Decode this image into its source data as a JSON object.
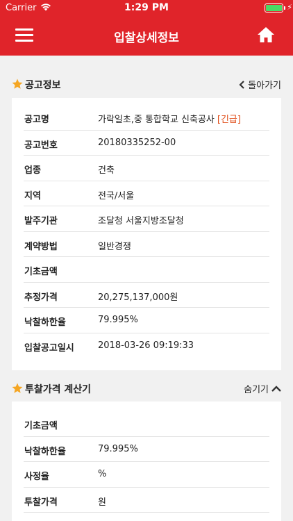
{
  "status_bar": {
    "carrier": "Carrier",
    "time": "1:29 PM"
  },
  "navbar": {
    "title": "입찰상세정보",
    "menu_icon": "hamburger-menu-icon",
    "home_icon": "home-icon"
  },
  "colors": {
    "primary": "#e0242a",
    "star": "#f5a623",
    "tag": "#e04e1a",
    "battery": "#4cd964"
  },
  "notice_section": {
    "title": "공고정보",
    "back_label": "돌아가기",
    "rows": [
      {
        "label": "공고명",
        "value": "가락일초,중 통합학교 신축공사",
        "tag": "[긴급]"
      },
      {
        "label": "공고번호",
        "value": "20180335252-00"
      },
      {
        "label": "업종",
        "value": "건축"
      },
      {
        "label": "지역",
        "value": "전국/서울"
      },
      {
        "label": "발주기관",
        "value": "조달청 서울지방조달청"
      },
      {
        "label": "계약방법",
        "value": "일반경쟁"
      },
      {
        "label": "기초금액",
        "value": ""
      },
      {
        "label": "추정가격",
        "value": "20,275,137,000원"
      },
      {
        "label": "낙찰하한율",
        "value": "79.995%"
      },
      {
        "label": "입찰공고일시",
        "value": "2018-03-26 09:19:33"
      }
    ]
  },
  "calculator_section": {
    "title": "투찰가격 계산기",
    "hide_label": "숨기기",
    "rows": [
      {
        "label": "기초금액",
        "value": ""
      },
      {
        "label": "낙찰하한율",
        "value": "79.995%"
      },
      {
        "label": "사정율",
        "value": "%"
      },
      {
        "label": "투찰가격",
        "value": "원"
      }
    ]
  }
}
